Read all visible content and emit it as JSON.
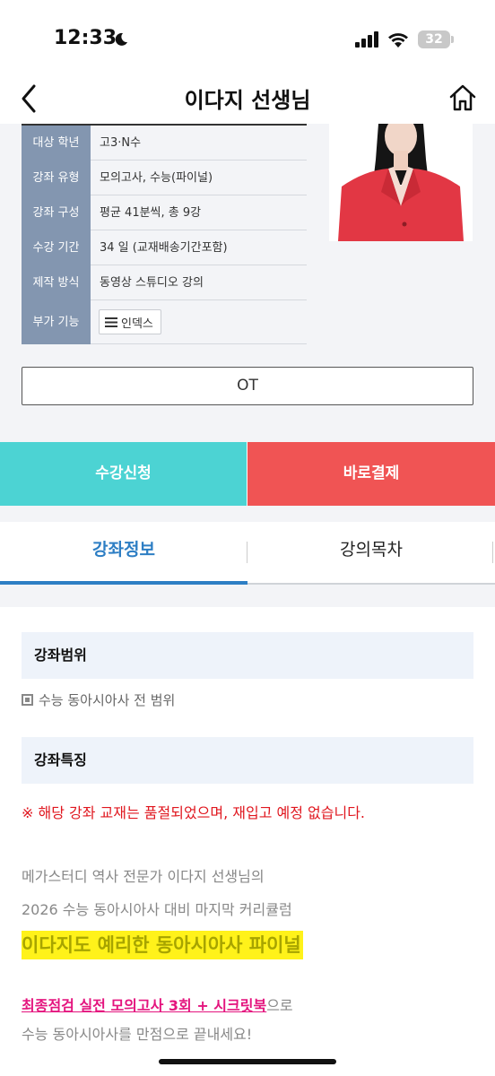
{
  "status_bar": {
    "time": "12:33",
    "battery": "32"
  },
  "nav": {
    "title": "이다지 선생님",
    "back_icon": "chevron-left-icon",
    "home_icon": "home-icon"
  },
  "info": {
    "rows": [
      {
        "label": "대상 학년",
        "value": "고3·N수"
      },
      {
        "label": "강좌 유형",
        "value": "모의고사, 수능(파이널)"
      },
      {
        "label": "강좌 구성",
        "value": "평균 41분씩, 총 9강"
      },
      {
        "label": "수강 기간",
        "value": "34 일 (교재배송기간포함)"
      },
      {
        "label": "제작 방식",
        "value": "동영상 스튜디오 강의"
      },
      {
        "label": "부가 기능",
        "value": "인덱스"
      }
    ],
    "ot_label": "OT"
  },
  "actions": {
    "enroll": "수강신청",
    "pay": "바로결제",
    "enroll_color": "#4cd3d3",
    "pay_color": "#f05454"
  },
  "tabs": [
    {
      "label": "강좌정보",
      "active": true
    },
    {
      "label": "강의목차",
      "active": false
    }
  ],
  "content": {
    "scope_title": "강좌범위",
    "scope_text": "수능 동아시아사 전 범위",
    "feature_title": "강좌특징",
    "notice": "※ 해당 강좌 교재는 품절되었으며, 재입고 예정 없습니다.",
    "desc1": "메가스터디 역사 전문가 이다지 선생님의",
    "desc2": "2026 수능 동아시아사 대비 마지막 커리큘럼",
    "highlight": "이다지도 예리한 동아시아사 파이널",
    "pink_link": "최종점검 실전 모의고사 3회 + 시크릿북",
    "pink_suffix": "으로",
    "last_line": "수능 동아시아사를 만점으로 끝내세요!"
  },
  "colors": {
    "accent_blue": "#2d7ec4",
    "label_bg": "#8396b0",
    "notice_red": "#e0171f",
    "link_pink": "#e4147e",
    "highlight_yellow": "#fff21a"
  }
}
